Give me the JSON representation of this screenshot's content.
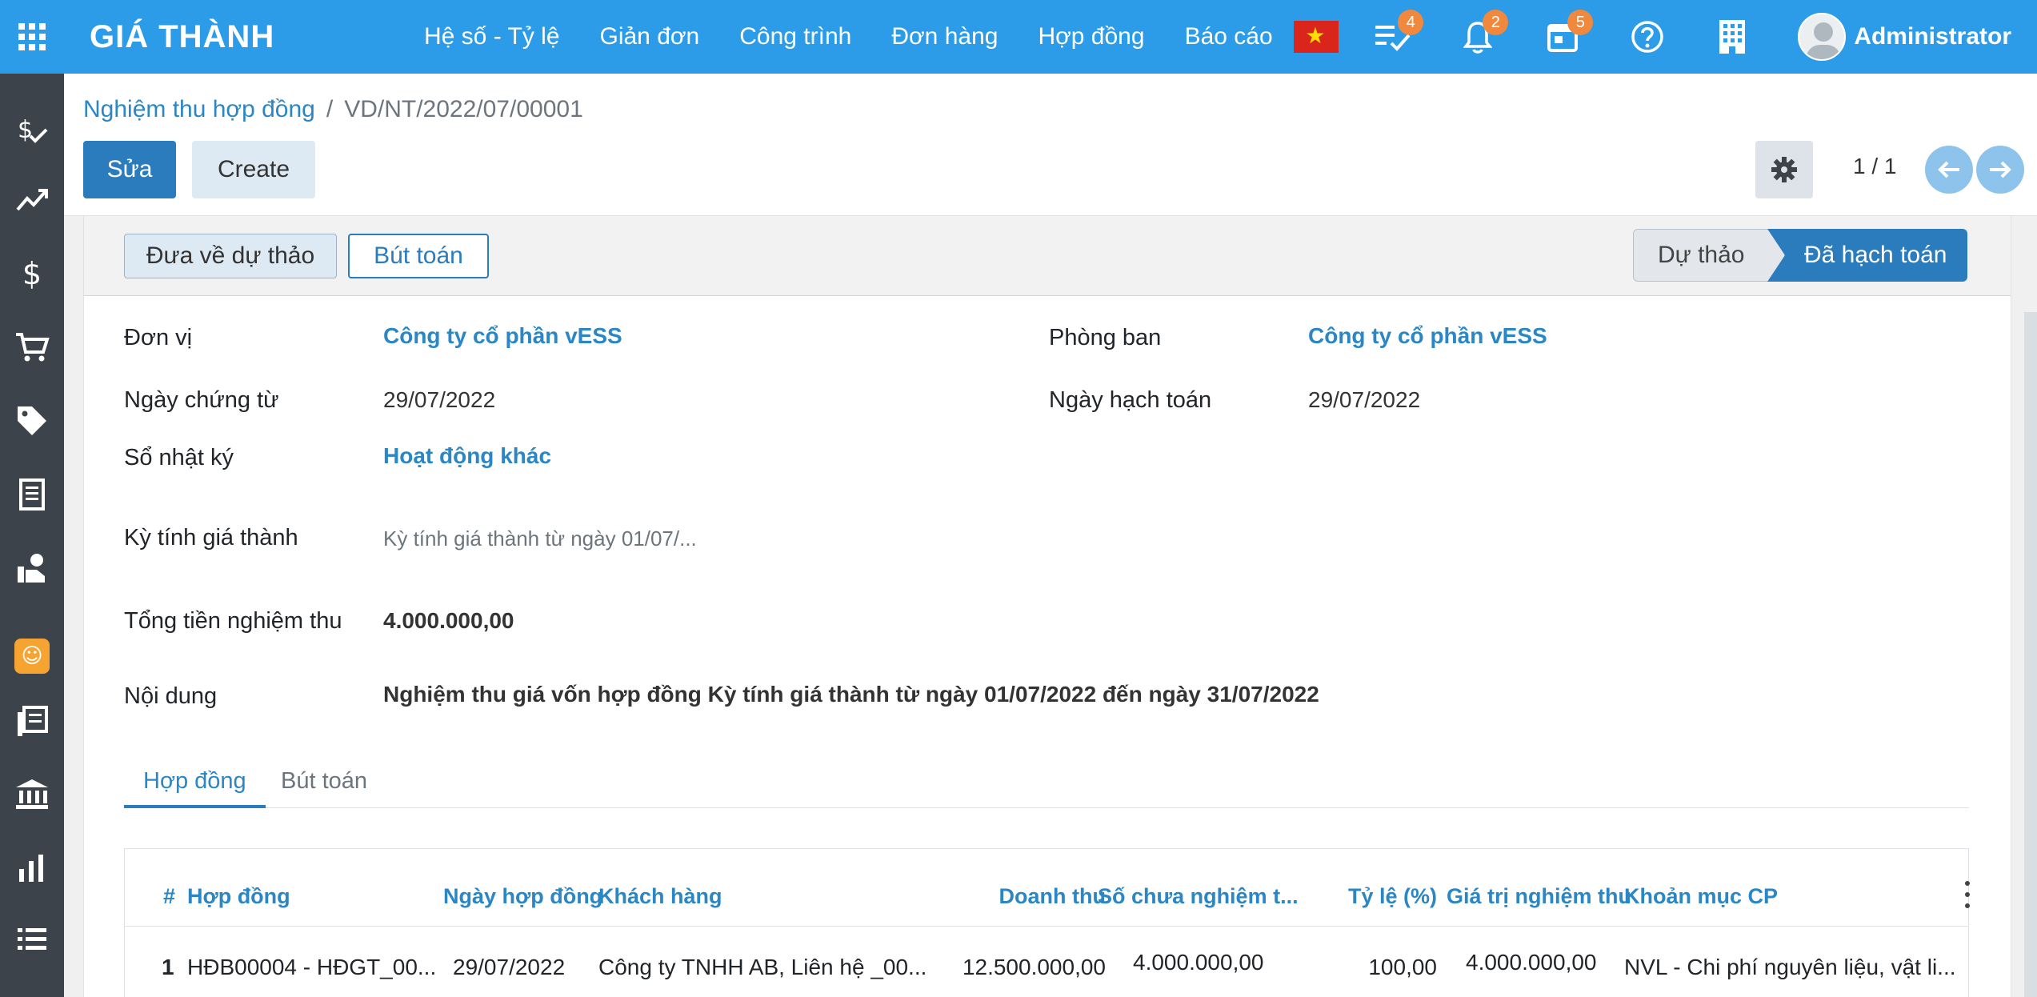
{
  "app": {
    "brand": "GIÁ THÀNH"
  },
  "menu": [
    {
      "label": "Hệ số - Tỷ lệ"
    },
    {
      "label": "Giản đơn"
    },
    {
      "label": "Công trình"
    },
    {
      "label": "Đơn hàng"
    },
    {
      "label": "Hợp đồng"
    },
    {
      "label": "Báo cáo"
    }
  ],
  "systray": {
    "activities_count": "4",
    "notifications_count": "2",
    "calendar_count": "5",
    "user_name": "Administrator"
  },
  "breadcrumb": {
    "parent": "Nghiệm thu hợp đồng",
    "separator": "/",
    "current": "VD/NT/2022/07/00001"
  },
  "actions": {
    "edit": "Sửa",
    "create": "Create"
  },
  "pager": {
    "value": "1 / 1"
  },
  "statusbar": {
    "reset_draft": "Đưa về dự thảo",
    "journal_entry": "Bút toán",
    "stages": [
      {
        "label": "Dự thảo",
        "active": false
      },
      {
        "label": "Đã hạch toán",
        "active": true
      }
    ]
  },
  "form": {
    "don_vi": {
      "label": "Đơn vị",
      "value": "Công ty cổ phần vESS"
    },
    "phong_ban": {
      "label": "Phòng ban",
      "value": "Công ty cổ phần vESS"
    },
    "ngay_chung_tu": {
      "label": "Ngày chứng từ",
      "value": "29/07/2022"
    },
    "ngay_hach_toan": {
      "label": "Ngày hạch toán",
      "value": "29/07/2022"
    },
    "so_nhat_ky": {
      "label": "Sổ nhật ký",
      "value": "Hoạt động khác"
    },
    "ky_tinh_gia_thanh": {
      "label": "Kỳ tính giá thành",
      "value": "Kỳ tính giá thành từ ngày 01/07/..."
    },
    "tong_tien": {
      "label": "Tổng tiền nghiệm thu",
      "value": "4.000.000,00"
    },
    "noi_dung": {
      "label": "Nội dung",
      "value": "Nghiệm thu giá vốn hợp đồng Kỳ tính giá thành từ ngày 01/07/2022 đến ngày 31/07/2022"
    }
  },
  "tabs": [
    {
      "label": "Hợp đồng",
      "active": true
    },
    {
      "label": "Bút toán",
      "active": false
    }
  ],
  "table": {
    "columns": [
      "#",
      "Hợp đồng",
      "Ngày hợp đồng",
      "Khách hàng",
      "Doanh thu",
      "Số chưa nghiệm t...",
      "Tỷ lệ (%)",
      "Giá trị nghiệm thu",
      "Khoản mục CP"
    ],
    "rows": [
      [
        "1",
        "HĐB00004 - HĐGT_00...",
        "29/07/2022",
        "Công ty TNHH AB, Liên hệ _00...",
        "12.500.000,00",
        "4.000.000,00",
        "100,00",
        "4.000.000,00",
        "NVL - Chi phí nguyên liệu, vật li..."
      ]
    ]
  },
  "colors": {
    "navbar": "#2d9ce8",
    "sidebar": "#3c434a",
    "primary": "#2b7cbd",
    "link": "#2a86c4",
    "badge": "#f0883e"
  }
}
